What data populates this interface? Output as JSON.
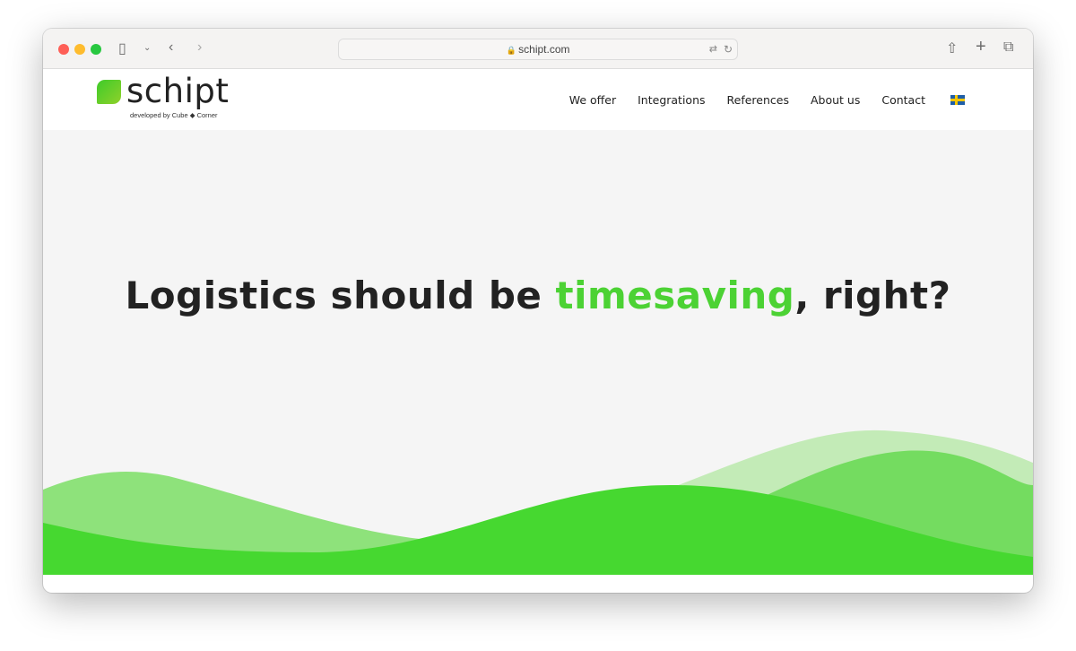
{
  "browser": {
    "url": "schipt.com"
  },
  "logo": {
    "name": "schipt",
    "sub": "developed by Cube ◆ Corner"
  },
  "nav": {
    "items": [
      "We offer",
      "Integrations",
      "References",
      "About us",
      "Contact"
    ],
    "flag": "swedish-flag"
  },
  "hero": {
    "before": "Logistics should be ",
    "highlight": "timesaving",
    "after": ", right?"
  },
  "colors": {
    "accent": "#4cd234",
    "wave_light": "#c3ebb7",
    "wave_mid": "#74dc60",
    "wave_dark": "#46d830"
  }
}
